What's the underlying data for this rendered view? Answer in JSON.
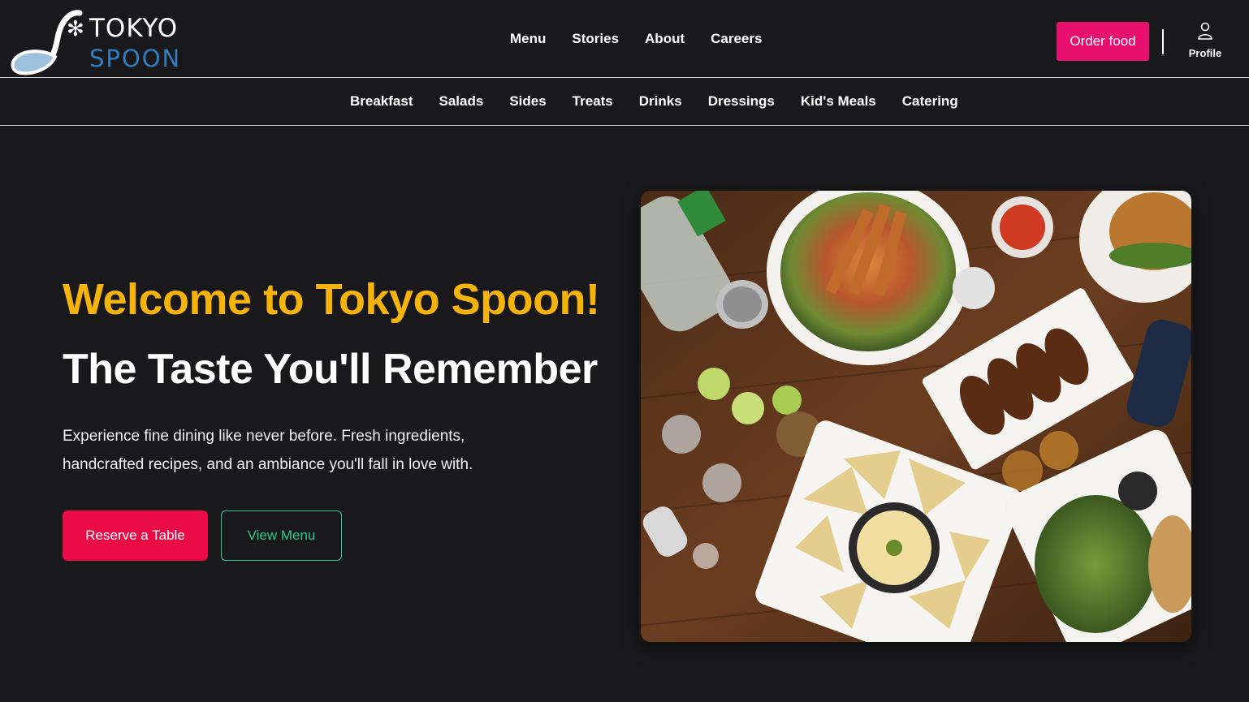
{
  "header": {
    "logo": {
      "line1": "TOKYO",
      "line2": "SPOON"
    },
    "nav": [
      {
        "label": "Menu"
      },
      {
        "label": "Stories"
      },
      {
        "label": "About"
      },
      {
        "label": "Careers"
      }
    ],
    "order_label": "Order food",
    "profile_label": "Profile"
  },
  "subnav": [
    {
      "label": "Breakfast"
    },
    {
      "label": "Salads"
    },
    {
      "label": "Sides"
    },
    {
      "label": "Treats"
    },
    {
      "label": "Drinks"
    },
    {
      "label": "Dressings"
    },
    {
      "label": "Kid's Meals"
    },
    {
      "label": "Catering"
    }
  ],
  "hero": {
    "title": "Welcome to Tokyo Spoon!",
    "subtitle": "The Taste You'll Remember",
    "description": "Experience fine dining like never before. Fresh ingredients, handcrafted recipes, and an ambiance you'll fall in love with.",
    "reserve_label": "Reserve a Table",
    "view_menu_label": "View Menu"
  },
  "colors": {
    "background": "#19191b",
    "accent_pink": "#e8106e",
    "reserve_red": "#ea0a46",
    "title_yellow": "#f5b30c",
    "green": "#2ec98c",
    "logo_blue": "#2f7dc0"
  },
  "icons": [
    "spoon-logo-icon",
    "flower-icon",
    "profile-user-icon"
  ]
}
